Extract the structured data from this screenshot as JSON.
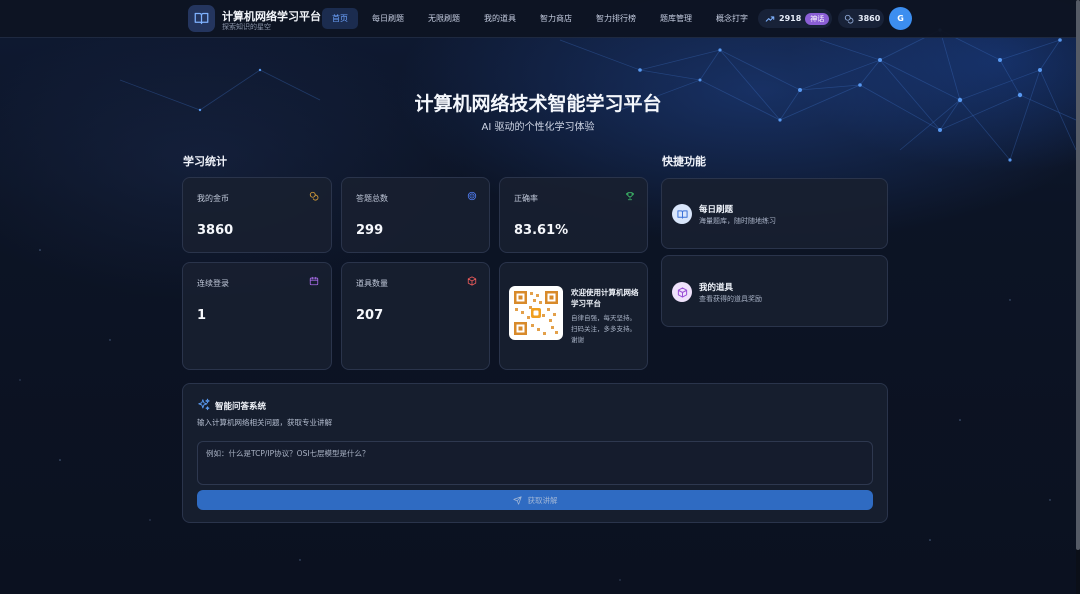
{
  "nav": {
    "brand_title": "计算机网络学习平台",
    "brand_subtitle": "探索知识的星空",
    "items": [
      {
        "label": "首页",
        "active": true
      },
      {
        "label": "每日刷题",
        "active": false
      },
      {
        "label": "无限刷题",
        "active": false
      },
      {
        "label": "我的道具",
        "active": false
      },
      {
        "label": "智力商店",
        "active": false
      },
      {
        "label": "智力排行榜",
        "active": false
      },
      {
        "label": "题库管理",
        "active": false
      },
      {
        "label": "概念打字",
        "active": false
      }
    ],
    "trend_value": "2918",
    "rank_badge": "神话",
    "coins": "3860",
    "avatar_initial": "G"
  },
  "hero": {
    "title": "计算机网络技术智能学习平台",
    "subtitle": "AI 驱动的个性化学习体验"
  },
  "stats": {
    "section_title": "学习统计",
    "coins_label": "我的金币",
    "coins_value": "3860",
    "answered_label": "答题总数",
    "answered_value": "299",
    "accuracy_label": "正确率",
    "accuracy_value": "83.61%",
    "login_label": "连续登录",
    "login_value": "1",
    "items_label": "道具数量",
    "items_value": "207"
  },
  "welcome": {
    "title": "欢迎使用计算机网络学习平台",
    "description": "自律自强，每天坚持。扫码关注，多多支持。谢谢"
  },
  "quick": {
    "section_title": "快捷功能",
    "daily_title": "每日刷题",
    "daily_desc": "海量题库，随时随地练习",
    "props_title": "我的道具",
    "props_desc": "查看获得的道具奖励"
  },
  "qa": {
    "title": "智能问答系统",
    "description": "输入计算机网络相关问题，获取专业讲解",
    "placeholder": "例如：什么是TCP/IP协议？OSI七层模型是什么？",
    "button_label": "获取讲解"
  },
  "colors": {
    "accent": "#3c8ef0",
    "coin_icon": "#e0a43a",
    "target_icon": "#4f7cf0",
    "trophy_icon": "#3fbf6a",
    "calendar_icon": "#a86ce8",
    "cube_icon": "#e85a5a"
  }
}
